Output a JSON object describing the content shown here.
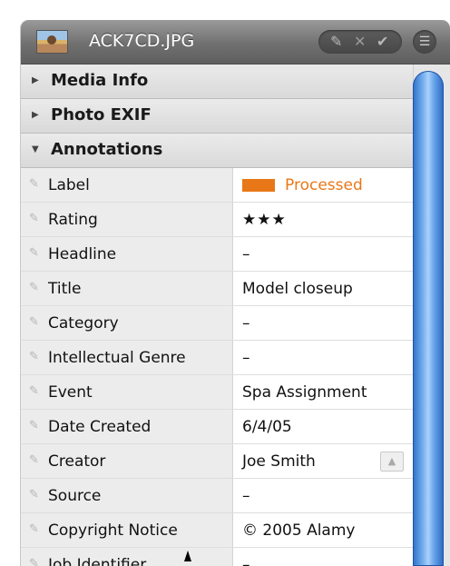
{
  "header": {
    "filename": "ACK7CD.JPG",
    "thumbnail_icon": "photo-thumbnail-icon",
    "tool_icons": [
      "pencil-icon",
      "x-icon",
      "checkmark-icon"
    ],
    "list_icon": "list-icon"
  },
  "sections": {
    "media_info": "Media Info",
    "photo_exif": "Photo EXIF",
    "annotations": "Annotations"
  },
  "fields": [
    {
      "label": "Label",
      "value": "Processed"
    },
    {
      "label": "Rating",
      "value": "★★★"
    },
    {
      "label": "Headline",
      "value": "–"
    },
    {
      "label": "Title",
      "value": "Model closeup"
    },
    {
      "label": "Category",
      "value": "–"
    },
    {
      "label": "Intellectual Genre",
      "value": "–"
    },
    {
      "label": "Event",
      "value": "Spa Assignment"
    },
    {
      "label": "Date Created",
      "value": "6/4/05"
    },
    {
      "label": "Creator",
      "value": "Joe Smith"
    },
    {
      "label": "Source",
      "value": "–"
    },
    {
      "label": "Copyright Notice",
      "value": "© 2005 Alamy"
    },
    {
      "label": "Job Identifier",
      "value": "–"
    }
  ],
  "colors": {
    "label_orange": "#e87817",
    "scroll_blue": "#4a8fe0"
  }
}
